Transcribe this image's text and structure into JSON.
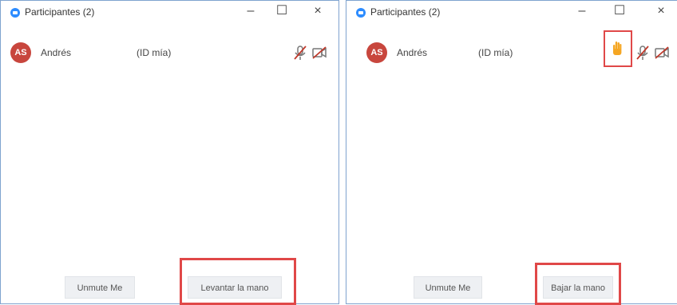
{
  "windows": [
    {
      "title": "Participantes (2)",
      "controls": {
        "minimize": "–",
        "maximize": "☐",
        "close": "×"
      },
      "participant": {
        "initials": "AS",
        "name": "Andrés",
        "id_label": "(ID mía)"
      },
      "buttons": {
        "unmute": "Unmute Me",
        "hand": "Levantar la mano"
      }
    },
    {
      "title": "Participantes (2)",
      "controls": {
        "minimize": "–",
        "maximize": "☐",
        "close": "×"
      },
      "participant": {
        "initials": "AS",
        "name": "Andrés",
        "id_label": "(ID mía)"
      },
      "buttons": {
        "unmute": "Unmute Me",
        "hand": "Bajar la mano"
      }
    }
  ],
  "colors": {
    "avatar": "#c8463d",
    "accent": "#2d8cff",
    "highlight": "#e04848",
    "hand": "#f5a623"
  },
  "icons": [
    "zoom-app-icon",
    "muted-mic-icon",
    "video-off-icon",
    "raised-hand-icon"
  ]
}
